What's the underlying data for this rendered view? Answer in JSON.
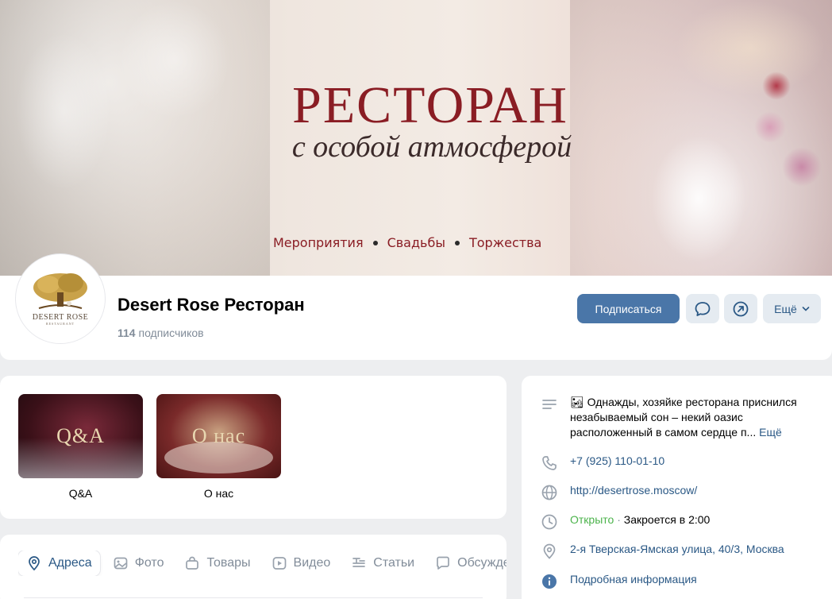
{
  "cover": {
    "title": "РЕСТОРАН",
    "subtitle": "с особой атмосферой",
    "tags": [
      "Мероприятия",
      "Свадьбы",
      "Торжества"
    ]
  },
  "avatar": {
    "logo_text": "DESERT ROSE",
    "logo_small": "RESTAURANT"
  },
  "profile": {
    "name": "Desert Rose Ресторан",
    "subscribers_count": "114",
    "subscribers_label": "подписчиков"
  },
  "actions": {
    "subscribe": "Подписаться",
    "more": "Ещё",
    "message_icon": "chat-bubble-icon",
    "share_icon": "share-arrow-icon"
  },
  "albums": [
    {
      "cover_text": "Q&A",
      "label": "Q&A"
    },
    {
      "cover_text": "О нас",
      "label": "О нас"
    }
  ],
  "tabs": [
    {
      "label": "Адреса",
      "icon": "map-pin-icon",
      "active": true
    },
    {
      "label": "Фото",
      "icon": "photo-icon",
      "active": false
    },
    {
      "label": "Товары",
      "icon": "bag-icon",
      "active": false
    },
    {
      "label": "Видео",
      "icon": "video-icon",
      "active": false
    },
    {
      "label": "Статьи",
      "icon": "articles-icon",
      "active": false
    },
    {
      "label": "Обсуждения",
      "icon": "discussion-icon",
      "active": false
    }
  ],
  "info": {
    "description_emoji": "🏜",
    "description": "Однажды, хозяйке ресторана приснился незабываемый сон – некий оазис расположенный в самом сердце п...",
    "description_more": "Ещё",
    "phone": "+7 (925) 110-01-10",
    "website": "http://desertrose.moscow/",
    "status_open": "Открыто",
    "status_separator": "·",
    "status_close": "Закроется в 2:00",
    "address": "2-я Тверская-Ямская улица, 40/3, Москва",
    "details": "Подробная информация"
  },
  "colors": {
    "accent": "#4a76a8",
    "link": "#2a5885",
    "open": "#4bb34b",
    "cover_red": "#8a1d24",
    "background": "#edeef0"
  }
}
